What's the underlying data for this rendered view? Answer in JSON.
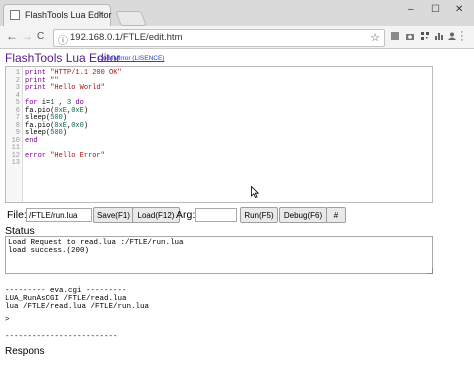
{
  "browser": {
    "tab_title": "FlashTools Lua Editor",
    "tab_close": "×",
    "url": "192.168.0.1/FTLE/edit.htm",
    "window_minimize": "–",
    "window_maximize": "☐",
    "window_close": "✕",
    "back_glyph": "←",
    "forward_glyph": "→",
    "reload_glyph": "C",
    "star_glyph": "☆"
  },
  "page": {
    "title": "FlashTools Lua Editor",
    "codemirror_link": "CodeMirror (LISENCE)"
  },
  "editor": {
    "line_numbers": [
      "1",
      "2",
      "3",
      "4",
      "5",
      "6",
      "7",
      "8",
      "9",
      "10",
      "11",
      "12",
      "13"
    ]
  },
  "controls": {
    "file_label": "File:",
    "file_value": "/FTLE/run.lua",
    "save_label": "Save(F1)",
    "load_label": "Load(F12)",
    "arg_label": "Arg:",
    "arg_value": "",
    "run_label": "Run(F5)",
    "debug_label": "Debug(F6)",
    "hash_label": "#"
  },
  "status": {
    "heading": "Status",
    "text": "Load Request to read.lua :/FTLE/run.lua\nload success.(200)"
  },
  "eva": {
    "header": "--------- eva.cgi ---------",
    "line1": "LUA_RunAsCGI /FTLE/read.lua",
    "line2": "lua /FTLE/read.lua /FTLE/run.lua",
    "prompt": ">",
    "divider": "-------------------------"
  },
  "response": {
    "heading": "Respons"
  },
  "colors": {
    "keyword": "#770088",
    "string": "#aa1111",
    "number": "#116644",
    "link": "#551a8b"
  }
}
